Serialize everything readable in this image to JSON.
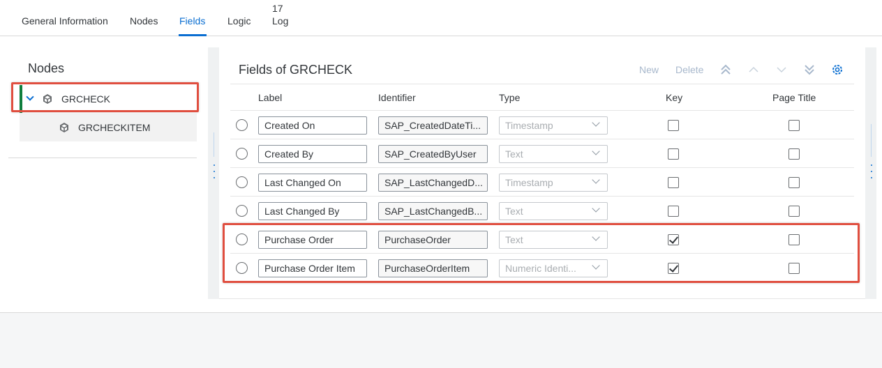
{
  "tabs": [
    {
      "label": "General Information",
      "count": null,
      "active": false
    },
    {
      "label": "Nodes",
      "count": null,
      "active": false
    },
    {
      "label": "Fields",
      "count": null,
      "active": true
    },
    {
      "label": "Logic",
      "count": null,
      "active": false
    },
    {
      "label": "Log",
      "count": "17",
      "active": false
    }
  ],
  "nodes_panel": {
    "title": "Nodes",
    "items": [
      {
        "label": "GRCHECK",
        "icon": "cube-icon",
        "expanded": true,
        "selected": true
      },
      {
        "label": "GRCHECKITEM",
        "icon": "cube-icon",
        "expanded": false,
        "selected": false
      }
    ]
  },
  "fields_panel": {
    "title": "Fields of GRCHECK",
    "toolbar": {
      "new_label": "New",
      "delete_label": "Delete",
      "icons": [
        "move-top-icon",
        "move-up-icon",
        "move-down-icon",
        "move-bottom-icon",
        "settings-icon"
      ]
    },
    "columns": [
      "Label",
      "Identifier",
      "Type",
      "Key",
      "Page Title"
    ],
    "rows": [
      {
        "label": "Created On",
        "identifier": "SAP_CreatedDateTi...",
        "type": "Timestamp",
        "key": false,
        "page_title": false
      },
      {
        "label": "Created By",
        "identifier": "SAP_CreatedByUser",
        "type": "Text",
        "key": false,
        "page_title": false
      },
      {
        "label": "Last Changed On",
        "identifier": "SAP_LastChangedD...",
        "type": "Timestamp",
        "key": false,
        "page_title": false
      },
      {
        "label": "Last Changed By",
        "identifier": "SAP_LastChangedB...",
        "type": "Text",
        "key": false,
        "page_title": false
      },
      {
        "label": "Purchase Order",
        "identifier": "PurchaseOrder",
        "type": "Text",
        "key": true,
        "page_title": false
      },
      {
        "label": "Purchase Order Item",
        "identifier": "PurchaseOrderItem",
        "type": "Numeric Identi...",
        "key": true,
        "page_title": false
      }
    ]
  },
  "colors": {
    "accent": "#0a6ed1",
    "selection_bar": "#107e3e",
    "highlight_box": "#e04e3f"
  }
}
